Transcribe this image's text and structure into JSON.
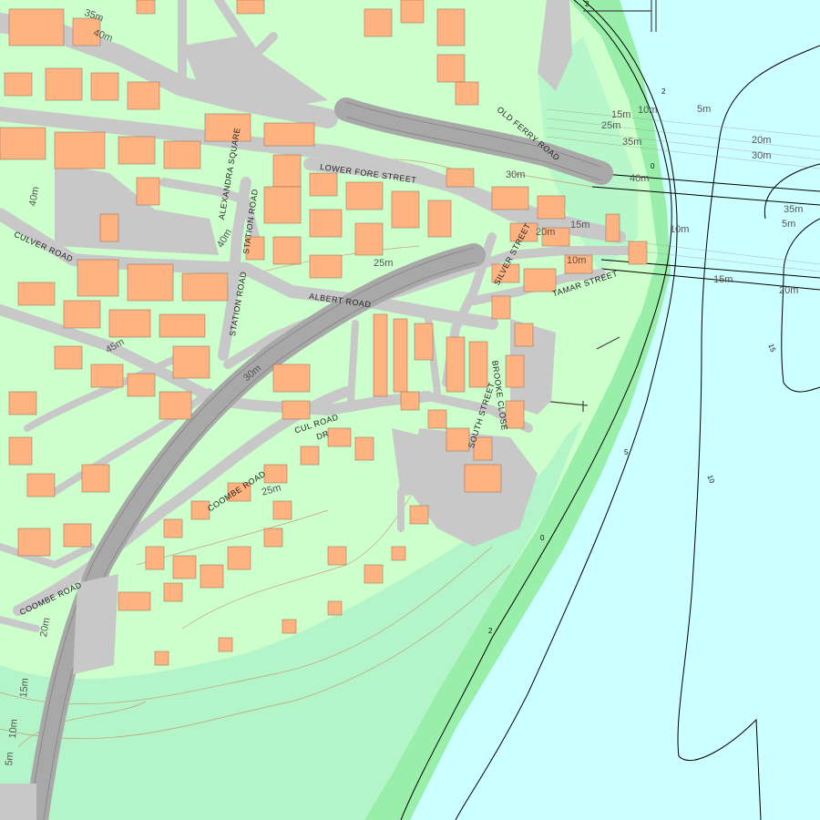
{
  "colors": {
    "sea": "#ccffff",
    "land": "#ccffcc",
    "foreshore": "#99eeaa",
    "vegetation": "#b3f5c8",
    "road": "#c8c8c8",
    "rail": "#b0b0b0",
    "building": "#ffb380",
    "contour_land": "#cc7755",
    "contour_sea": "#000000"
  },
  "streets": {
    "lower_fore_street": "LOWER FORE STREET",
    "old_ferry_road": "OLD FERRY ROAD",
    "alexandra_square": "ALEXANDRA SQUARE",
    "station_road_1": "STATION ROAD",
    "station_road_2": "STATION ROAD",
    "culver_road": "CULVER ROAD",
    "albert_road": "ALBERT ROAD",
    "silver_street": "SILVER STREET",
    "tamar_street": "TAMAR STREET",
    "brooke_close": "BROOKE CLOSE",
    "cul_road": "CUL ROAD",
    "cul_road_dr": "DR",
    "coombe_road_1": "COOMBE ROAD",
    "coombe_road_2": "COOMBE ROAD",
    "south_street": "SOUTH STREET"
  },
  "land_contours": {
    "c35": "35m",
    "c40a": "40m",
    "c40b": "40m",
    "c40c": "40m",
    "c45": "45m",
    "c30": "30m",
    "c25a": "25m",
    "c25b": "25m",
    "c30b": "30m",
    "c15a": "15m",
    "c20a": "20m",
    "c10a": "10m",
    "c20b": "20m",
    "c15b": "15m",
    "c10b": "10m",
    "c5": "5m"
  },
  "sea_contours": {
    "s15a": "15m",
    "s10a": "10m",
    "s5a": "5m",
    "s25": "25m",
    "s35": "35m",
    "s20a": "20m",
    "s30": "30m",
    "s40": "40m",
    "s35b": "35m",
    "s5b": "5m",
    "s10b": "10m",
    "s15b": "15m",
    "s20b": "20m"
  },
  "depth_marks": {
    "d2a": "2",
    "d2b": "2",
    "d0a": "0",
    "d15": "15",
    "d5": "5",
    "d10": "10",
    "d0b": "0",
    "d2c": "2"
  }
}
